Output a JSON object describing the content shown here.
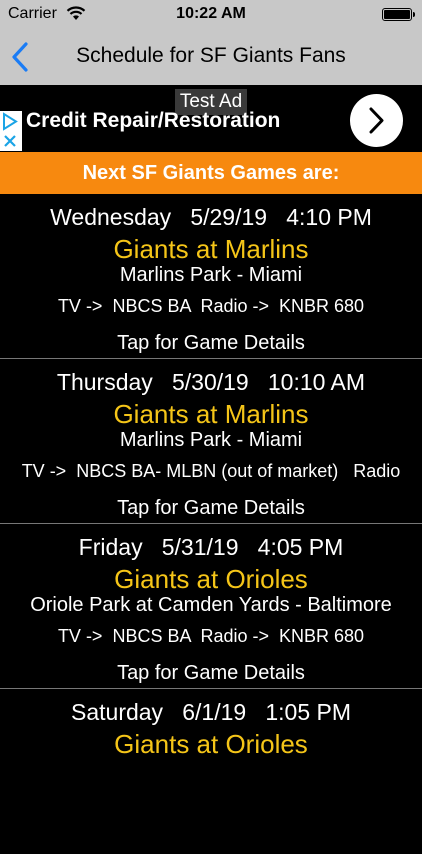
{
  "status_bar": {
    "carrier": "Carrier",
    "time": "10:22 AM"
  },
  "nav": {
    "title": "Schedule for SF Giants Fans"
  },
  "ad": {
    "label": "Test Ad",
    "text": "Credit Repair/Restoration"
  },
  "banner": {
    "text": "Next SF Giants Games are:"
  },
  "games": [
    {
      "date": "Wednesday   5/29/19   4:10 PM",
      "matchup": "Giants at Marlins",
      "venue": "Marlins Park - Miami",
      "media": "TV ->  NBCS BA  Radio ->  KNBR 680",
      "tap": "Tap for Game Details"
    },
    {
      "date": "Thursday   5/30/19   10:10 AM",
      "matchup": "Giants at Marlins",
      "venue": "Marlins Park - Miami",
      "media": "TV ->  NBCS BA- MLBN (out of market)   Radio",
      "tap": "Tap for Game Details"
    },
    {
      "date": "Friday   5/31/19   4:05 PM",
      "matchup": "Giants at Orioles",
      "venue": "Oriole Park at Camden Yards - Baltimore",
      "media": "TV ->  NBCS BA  Radio ->  KNBR 680",
      "tap": "Tap for Game Details"
    },
    {
      "date": "Saturday   6/1/19   1:05 PM",
      "matchup": "Giants at Orioles",
      "venue": "",
      "media": "",
      "tap": ""
    }
  ]
}
